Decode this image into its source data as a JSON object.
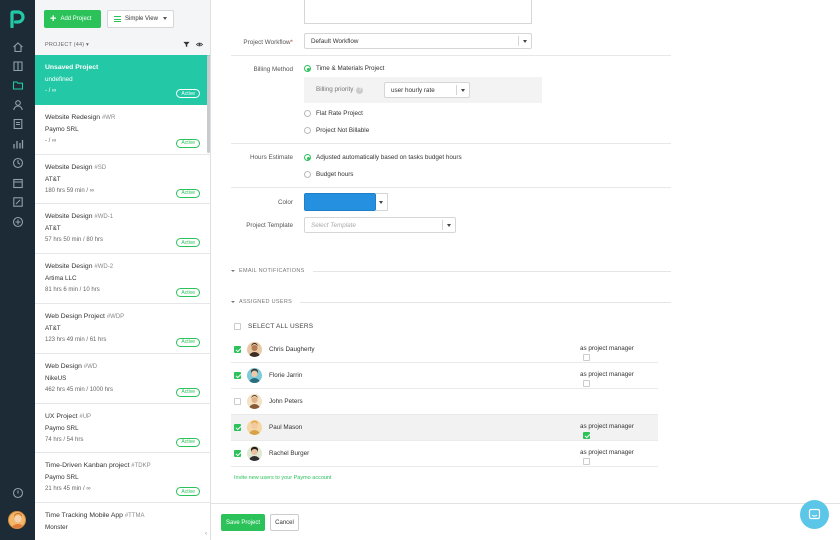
{
  "toolbar": {
    "add_label": "Add Project",
    "view_label": "Simple View"
  },
  "list": {
    "header": "PROJECT (44) ▾",
    "projects": [
      {
        "name": "Unsaved Project",
        "code": "",
        "client": "undefined",
        "hours": "- / ∞",
        "status": "Active"
      },
      {
        "name": "Website Redesign",
        "code": "#WR",
        "client": "Paymo SRL",
        "hours": "- / ∞",
        "status": "Active"
      },
      {
        "name": "Website Design",
        "code": "#SD",
        "client": "AT&T",
        "hours": "180 hrs 59 min / ∞",
        "status": "Active"
      },
      {
        "name": "Website Design",
        "code": "#WD-1",
        "client": "AT&T",
        "hours": "57 hrs 50 min / 80 hrs",
        "status": "Active"
      },
      {
        "name": "Website Design",
        "code": "#WD-2",
        "client": "Artima LLC",
        "hours": "81 hrs 6 min / 10 hrs",
        "status": "Active"
      },
      {
        "name": "Web Design Project",
        "code": "#WDP",
        "client": "AT&T",
        "hours": "123 hrs 49 min / 61 hrs",
        "status": "Active"
      },
      {
        "name": "Web Design",
        "code": "#WD",
        "client": "NikeUS",
        "hours": "462 hrs 45 min / 1000 hrs",
        "status": "Active"
      },
      {
        "name": "UX Project",
        "code": "#UP",
        "client": "Paymo SRL",
        "hours": "74 hrs / 54 hrs",
        "status": "Active"
      },
      {
        "name": "Time-Driven Kanban project",
        "code": "#TDKP",
        "client": "Paymo SRL",
        "hours": "21 hrs 45 min / ∞",
        "status": "Active"
      },
      {
        "name": "Time Tracking Mobile App",
        "code": "#TTMA",
        "client": "Monster",
        "hours": "",
        "status": ""
      }
    ]
  },
  "form": {
    "workflow_label": "Project Workflow",
    "workflow_required": "*",
    "workflow_value": "Default Workflow",
    "billing_label": "Billing Method",
    "billing_options": [
      "Time & Materials Project",
      "Flat Rate Project",
      "Project Not Billable"
    ],
    "billing_priority_label": "Billing priority",
    "billing_priority_help": "?",
    "billing_priority_value": "user hourly rate",
    "hours_label": "Hours Estimate",
    "hours_options": [
      "Adjusted automatically based on tasks budget hours",
      "Budget hours"
    ],
    "color_label": "Color",
    "color_value": "#2590e0",
    "template_label": "Project Template",
    "template_placeholder": "Select Template"
  },
  "sections": {
    "email": "EMAIL NOTIFICATIONS",
    "users": "ASSIGNED USERS"
  },
  "users": {
    "select_all": "SELECT ALL USERS",
    "pm_label": "as project manager",
    "list": [
      {
        "name": "Chris Daugherty",
        "checked": true,
        "pm": false,
        "pm_visible": true
      },
      {
        "name": "Florie Jarrin",
        "checked": true,
        "pm": false,
        "pm_visible": true
      },
      {
        "name": "John Peters",
        "checked": false,
        "pm": false,
        "pm_visible": false
      },
      {
        "name": "Paul Mason",
        "checked": true,
        "pm": true,
        "pm_visible": true
      },
      {
        "name": "Rachel Burger",
        "checked": true,
        "pm": false,
        "pm_visible": true
      }
    ],
    "invite": "Invite new users to your Paymo account"
  },
  "footer": {
    "save": "Save Project",
    "cancel": "Cancel"
  },
  "colors": {
    "accent": "#23c8a6",
    "green": "#2bc25a",
    "rail": "#1c2b36"
  }
}
